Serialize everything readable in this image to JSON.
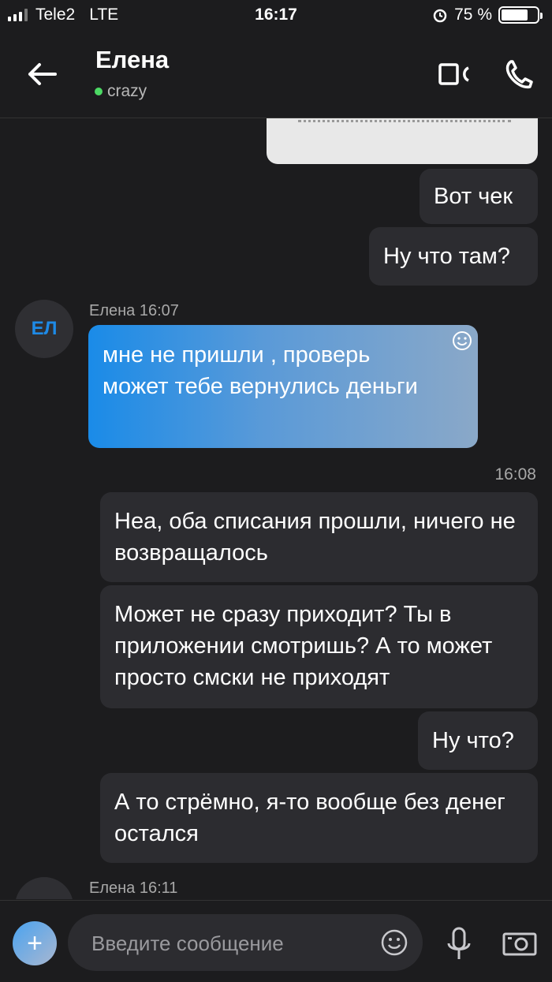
{
  "status_bar": {
    "carrier": "Tele2",
    "network": "LTE",
    "time": "16:17",
    "battery": "75 %",
    "battery_level": 0.75
  },
  "header": {
    "contact_name": "Елена",
    "contact_status": "crazy"
  },
  "messages": {
    "m1": "Вот чек",
    "m2": "Ну что там?",
    "incoming_meta_1": "Елена 16:07",
    "avatar_initials": "ЕЛ",
    "m3": "мне не пришли , проверь может тебе вернулись деньги",
    "timestamp_1": "16:08",
    "m4": "Неа, оба списания прошли, ничего не возвращалось",
    "m5": "Может не сразу приходит? Ты в приложении смотришь? А то может просто смски не приходят",
    "m6": "Ну что?",
    "m7": "А то стрёмно, я-то вообще без денег остался",
    "incoming_meta_2": "Елена 16:11"
  },
  "composer": {
    "placeholder": "Введите сообщение"
  },
  "colors": {
    "background": "#1c1c1e",
    "outgoing_bubble": "#2c2c30",
    "accent": "#1a8be8",
    "online": "#4cd964"
  }
}
